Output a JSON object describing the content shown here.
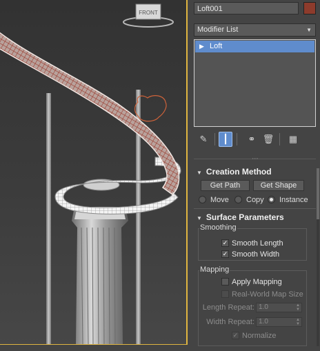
{
  "viewport": {
    "viewcube_label": "FRONT"
  },
  "panel": {
    "object_name": "Loft001",
    "object_color": "#8d3b2c",
    "modifier_list_label": "Modifier List",
    "stack_items": [
      {
        "label": "Loft"
      }
    ],
    "tools": [
      "pin-stack-icon",
      "show-end-result-icon",
      "make-unique-icon",
      "remove-modifier-icon",
      "configure-modifier-sets-icon"
    ],
    "creation_method": {
      "title": "Creation Method",
      "get_path": "Get Path",
      "get_shape": "Get Shape",
      "options": [
        "Move",
        "Copy",
        "Instance"
      ],
      "selected": "Instance"
    },
    "surface_parameters": {
      "title": "Surface Parameters",
      "smoothing_label": "Smoothing",
      "smooth_length": "Smooth Length",
      "smooth_width": "Smooth Width",
      "mapping_label": "Mapping",
      "apply_mapping": "Apply Mapping",
      "real_world": "Real-World Map Size",
      "length_repeat_label": "Length Repeat:",
      "length_repeat_value": "1.0",
      "width_repeat_label": "Width Repeat:",
      "width_repeat_value": "1.0",
      "normalize": "Normalize"
    }
  },
  "colors": {
    "selection": "#5f8ccd",
    "viewport_border": "#e1b640",
    "rail_wire": "#a0463a"
  }
}
